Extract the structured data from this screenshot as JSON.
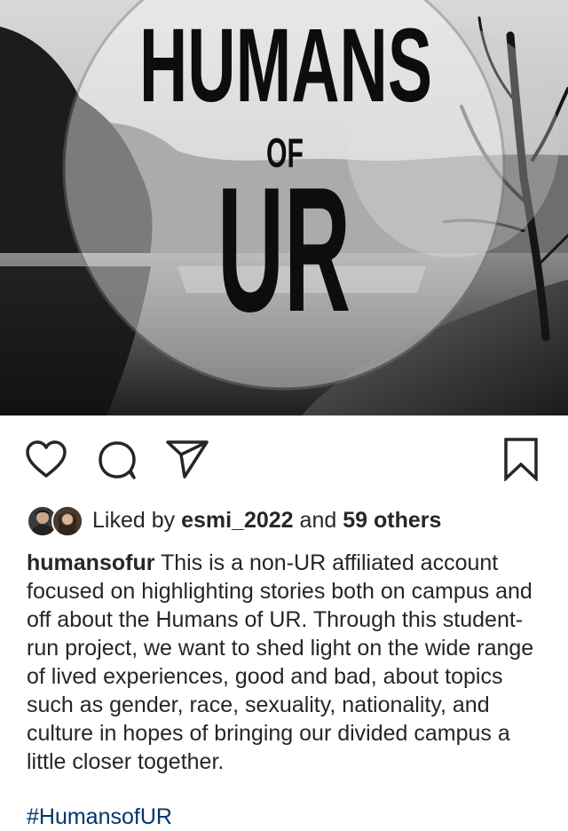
{
  "post": {
    "image_alt": "Humans of UR logo over black and white lake photo",
    "logo": {
      "line1": "HUMANS",
      "line2": "OF",
      "line3": "UR"
    }
  },
  "actions": {
    "like_icon": "heart-icon",
    "comment_icon": "comment-icon",
    "share_icon": "paper-plane-icon",
    "save_icon": "bookmark-icon"
  },
  "likes": {
    "prefix": "Liked by",
    "user": "esmi_2022",
    "connector": "and",
    "others": "59 others"
  },
  "caption": {
    "username": "humansofur",
    "text": "This is a non-UR affiliated account focused on highlighting stories both on campus and off about the Humans of UR. Through this student-run project, we want to shed light on the wide range of lived experiences, good and bad, about topics such as gender, race, sexuality, nationality, and culture in hopes of bringing our divided campus a little closer together.",
    "hashtag": "#HumansofUR"
  },
  "colors": {
    "text": "#262626",
    "link": "#00376b",
    "background": "#ffffff"
  }
}
